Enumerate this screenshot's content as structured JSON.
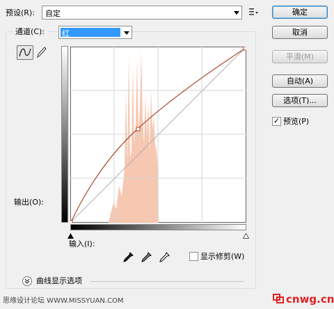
{
  "preset": {
    "label": "预设(R):",
    "value": "自定"
  },
  "channel": {
    "label": "通道(C):",
    "value": "红"
  },
  "output_label": "输出(O):",
  "input_label": "输入(I):",
  "buttons": {
    "ok": "确定",
    "cancel": "取消",
    "smooth": "平滑(M)",
    "auto": "自动(A)",
    "options": "选项(T)..."
  },
  "preview": {
    "label": "预览(P)",
    "checked": true
  },
  "show_clipping": {
    "label": "显示修剪(W)",
    "checked": false
  },
  "curve_display_options": "曲线显示选项",
  "watermark_left": "思缘设计论坛 WWW.MISSYUAN.COM",
  "watermark_right": "cnwg.cn",
  "colors": {
    "curve": "#a84a2a",
    "histogram": "#f5c4ad",
    "default_button": "#3c7fb1"
  },
  "curve_points": [
    [
      0,
      0
    ],
    [
      96,
      135
    ],
    [
      255,
      255
    ]
  ],
  "icons": [
    "curve-tool-icon",
    "pencil-icon",
    "preset-menu-icon",
    "black-eyedropper-icon",
    "gray-eyedropper-icon",
    "white-eyedropper-icon",
    "expand-chevron-icon"
  ]
}
